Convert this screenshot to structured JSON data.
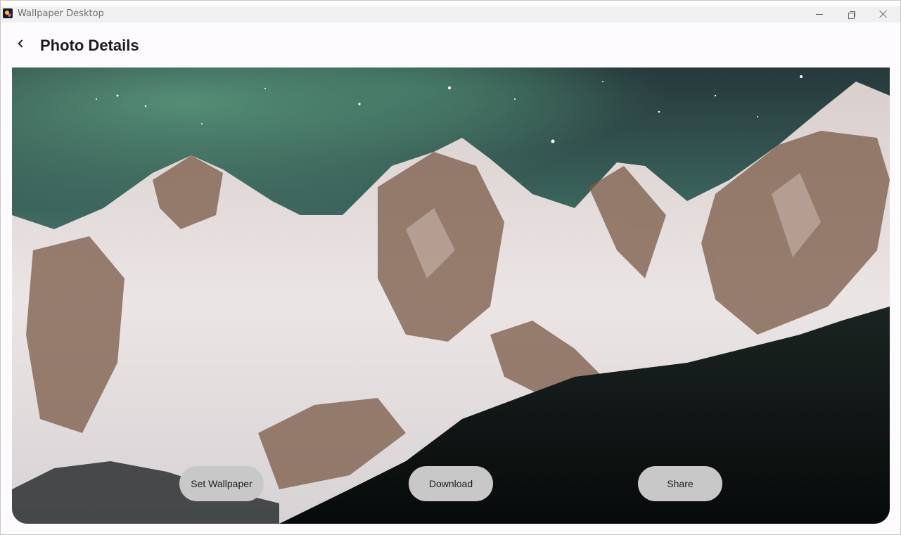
{
  "window": {
    "title": "Wallpaper Desktop",
    "controls": [
      "minimize-icon",
      "restore-icon",
      "close-icon"
    ]
  },
  "appbar": {
    "back_icon": "chevron-left-icon",
    "title": "Photo Details"
  },
  "photo": {
    "subject": "snowy mountain range under night sky with aurora",
    "colors": {
      "sky_top": "#2a3a3c",
      "aurora": "#4f8a73",
      "snow": "#e8e2e2",
      "rock": "#7a5a45",
      "forest": "#0f1514"
    }
  },
  "actions": {
    "set_wallpaper": "Set Wallpaper",
    "download": "Download",
    "share": "Share"
  }
}
